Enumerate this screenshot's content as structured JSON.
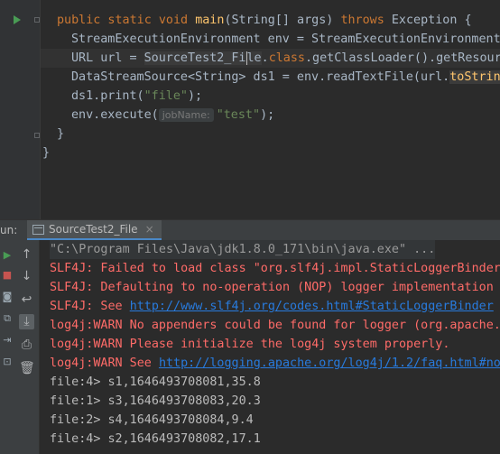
{
  "editor": {
    "lines": {
      "l1": {
        "kw1": "public static void ",
        "fn": "main",
        "t1": "(String[] args) ",
        "kw2": "throws ",
        "t2": "Exception {"
      },
      "l2": {
        "t1": "StreamExecutionEnvironment env = StreamExecutionEnvironment"
      },
      "l3": {
        "t1": "URL url = ",
        "cls": "SourceTest2_Fi",
        "cls2": "le",
        "t2": ".",
        "kw": "class",
        "t3": ".getClassLoader().getResourc"
      },
      "l4": {
        "t1": "DataStreamSource<String> ds1 = env.readTextFile(url.",
        "m": "toString"
      },
      "l5": {
        "t1": "ds1.print(",
        "s": "\"file\"",
        "t2": ");"
      },
      "l6": {
        "t1": "env.execute(",
        "hint": "jobName:",
        "s": "\"test\"",
        "t2": ");"
      },
      "l7": {
        "t1": "}"
      },
      "l8": {
        "t1": "}"
      }
    }
  },
  "run": {
    "label": "un:",
    "tab_label": "SourceTest2_File",
    "tab_close": "×"
  },
  "console": {
    "cmd": "\"C:\\Program Files\\Java\\jdk1.8.0_171\\bin\\java.exe\" ...",
    "e1": "SLF4J: Failed to load class \"org.slf4j.impl.StaticLoggerBinder\"",
    "e2": "SLF4J: Defaulting to no-operation (NOP) logger implementation",
    "e3_pre": "SLF4J: See ",
    "e3_link": "http://www.slf4j.org/codes.html#StaticLoggerBinder",
    "e3_post": " f",
    "e4": "log4j:WARN No appenders could be found for logger (org.apache.f",
    "e5": "log4j:WARN Please initialize the log4j system properly.",
    "e6_pre": "log4j:WARN See ",
    "e6_link": "http://logging.apache.org/log4j/1.2/faq.html#noc",
    "out": [
      "file:4> s1,1646493708081,35.8",
      "file:1> s3,1646493708083,20.3",
      "file:2> s4,1646493708084,9.4",
      "file:4> s2,1646493708082,17.1"
    ]
  },
  "colors": {
    "error": "#ff6b68",
    "link": "#287bde",
    "keyword": "#cc7832",
    "string": "#6a8759",
    "run": "#499c54"
  }
}
